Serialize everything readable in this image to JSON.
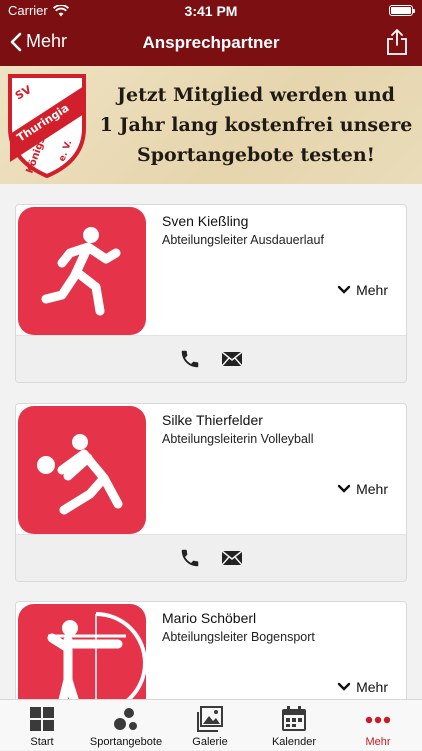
{
  "status": {
    "carrier": "Carrier",
    "time": "3:41 PM"
  },
  "nav": {
    "back_label": "Mehr",
    "title": "Ansprechpartner"
  },
  "banner": {
    "logo": {
      "line1": "SV",
      "line2": "Thuringia",
      "line3": "Königsee",
      "line4": "e. V."
    },
    "lines": [
      "Jetzt Mitglied werden und",
      "1 Jahr lang kostenfrei unsere",
      "Sportangebote testen!"
    ]
  },
  "contacts": [
    {
      "name": "Sven Kießling",
      "role": "Abteilungsleiter Ausdauerlauf",
      "more_label": "Mehr",
      "icon": "runner-icon"
    },
    {
      "name": "Silke Thierfelder",
      "role": "Abteilungsleiterin Volleyball",
      "more_label": "Mehr",
      "icon": "volleyball-player-icon"
    },
    {
      "name": "Mario Schöberl",
      "role": "Abteilungsleiter Bogensport",
      "more_label": "Mehr",
      "icon": "archer-icon"
    }
  ],
  "tabs": [
    {
      "label": "Start",
      "icon": "grid-icon"
    },
    {
      "label": "Sportangebote",
      "icon": "balls-icon"
    },
    {
      "label": "Galerie",
      "icon": "gallery-icon"
    },
    {
      "label": "Kalender",
      "icon": "calendar-icon"
    },
    {
      "label": "Mehr",
      "icon": "more-dots-icon",
      "active": true
    }
  ],
  "colors": {
    "header": "#7b0f12",
    "accent": "#c91c23",
    "tile": "#e5344a"
  }
}
